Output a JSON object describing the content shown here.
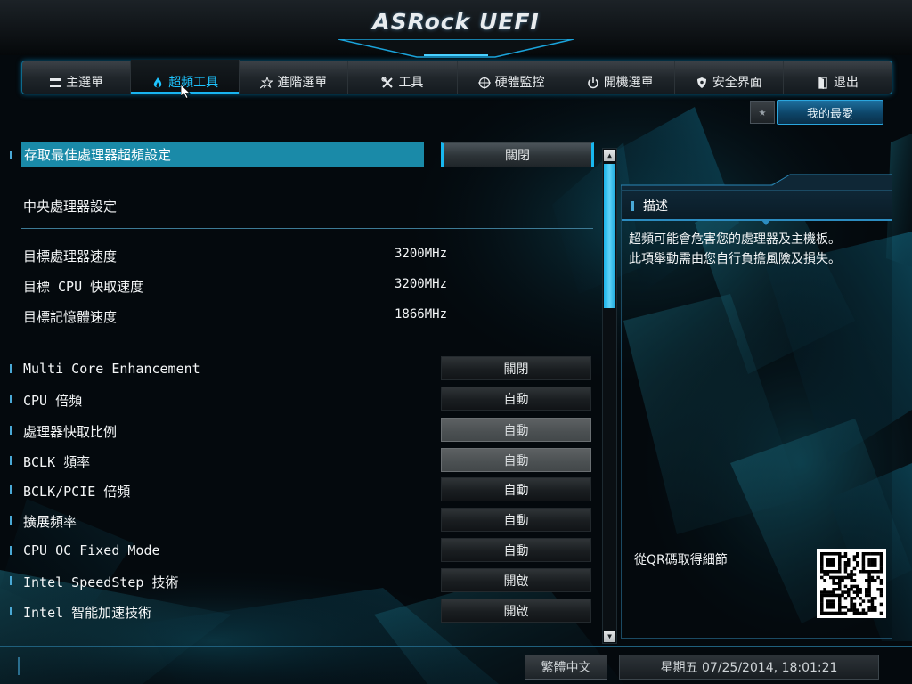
{
  "header": {
    "brand": "ASRock UEFI"
  },
  "nav": {
    "items": [
      {
        "label": "主選單",
        "icon": "list-icon",
        "active": false
      },
      {
        "label": "超頻工具",
        "icon": "flame-icon",
        "active": true
      },
      {
        "label": "進階選單",
        "icon": "star-arrow-icon",
        "active": false
      },
      {
        "label": "工具",
        "icon": "tools-icon",
        "active": false
      },
      {
        "label": "硬體監控",
        "icon": "crosshair-icon",
        "active": false
      },
      {
        "label": "開機選單",
        "icon": "power-icon",
        "active": false
      },
      {
        "label": "安全界面",
        "icon": "shield-icon",
        "active": false
      },
      {
        "label": "退出",
        "icon": "exit-door-icon",
        "active": false
      }
    ]
  },
  "favorites": {
    "star_icon": "star-icon",
    "label": "我的最愛"
  },
  "settings": {
    "selected": {
      "label": "存取最佳處理器超頻設定",
      "value": "關閉"
    },
    "section_header": "中央處理器設定",
    "info": [
      {
        "label": "目標處理器速度",
        "value": "3200MHz"
      },
      {
        "label": "目標 CPU 快取速度",
        "value": "3200MHz"
      },
      {
        "label": "目標記憶體速度",
        "value": "1866MHz"
      }
    ],
    "options": [
      {
        "label": "Multi Core Enhancement",
        "value": "關閉",
        "dim": false
      },
      {
        "label": "CPU 倍頻",
        "value": "自動",
        "dim": false
      },
      {
        "label": "處理器快取比例",
        "value": "自動",
        "dim": true
      },
      {
        "label": "BCLK 頻率",
        "value": "自動",
        "dim": true
      },
      {
        "label": "BCLK/PCIE 倍頻",
        "value": "自動",
        "dim": false
      },
      {
        "label": "擴展頻率",
        "value": "自動",
        "dim": false
      },
      {
        "label": "CPU OC Fixed Mode",
        "value": "自動",
        "dim": false
      },
      {
        "label": "Intel SpeedStep 技術",
        "value": "開啟",
        "dim": false
      },
      {
        "label": "Intel 智能加速技術",
        "value": "開啟",
        "dim": false
      }
    ]
  },
  "description": {
    "title": "描述",
    "line1": "超頻可能會危害您的處理器及主機板。",
    "line2": "此項舉動需由您自行負擔風險及損失。",
    "qr_label": "從QR碼取得細節"
  },
  "footer": {
    "language": "繁體中文",
    "datetime": "星期五 07/25/2014, 18:01:21"
  },
  "colors": {
    "accent": "#1ec4ff",
    "selected_row": "#1a8aa8",
    "button_dim": "#4f5457",
    "favorites_button": "#0d4568"
  }
}
